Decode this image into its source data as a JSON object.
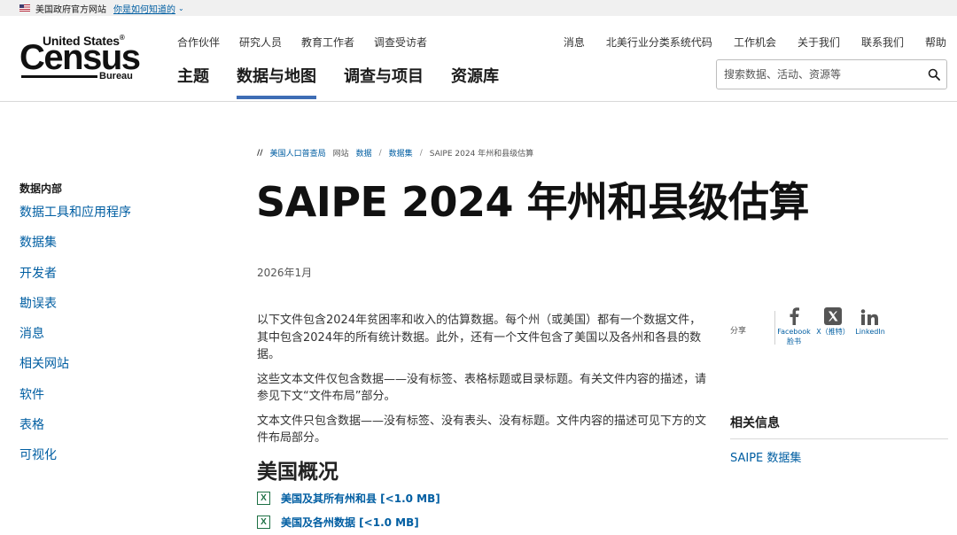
{
  "gov_banner": {
    "text": "美国政府官方网站",
    "link": "你是如何知道的"
  },
  "logo": {
    "line1": "United States",
    "reg": "®",
    "line2": "Census",
    "line3": "Bureau"
  },
  "utility_nav": [
    "合作伙伴",
    "研究人员",
    "教育工作者",
    "调查受访者"
  ],
  "right_nav": [
    "消息",
    "北美行业分类系统代码",
    "工作机会",
    "关于我们",
    "联系我们",
    "帮助"
  ],
  "main_nav": [
    {
      "label": "主题",
      "active": false
    },
    {
      "label": "数据与地图",
      "active": true
    },
    {
      "label": "调查与项目",
      "active": false
    },
    {
      "label": "资源库",
      "active": false
    }
  ],
  "search": {
    "placeholder": "搜索数据、活动、资源等"
  },
  "sidebar": {
    "heading": "数据内部",
    "items": [
      "数据工具和应用程序",
      "数据集",
      "开发者",
      "勘误表",
      "消息",
      "相关网站",
      "软件",
      "表格",
      "可视化"
    ]
  },
  "breadcrumb": {
    "lead": "//",
    "items": [
      {
        "label": "美国人口普查局",
        "link": true
      },
      {
        "label": "网站",
        "link": false
      },
      {
        "label": "数据",
        "link": true
      },
      {
        "label": "/",
        "link": false
      },
      {
        "label": "数据集",
        "link": true
      },
      {
        "label": "/",
        "link": false
      },
      {
        "label": "SAIPE 2024 年州和县级估算",
        "link": false
      }
    ]
  },
  "page": {
    "title": "SAIPE 2024 年州和县级估算",
    "date": "2026年1月",
    "paragraphs": [
      "以下文件包含2024年贫困率和收入的估算数据。每个州（或美国）都有一个数据文件，其中包含2024年的所有统计数据。此外，还有一个文件包含了美国以及各州和各县的数据。",
      "这些文本文件仅包含数据——没有标签、表格标题或目录标题。有关文件内容的描述，请参见下文“文件布局”部分。",
      "文本文件只包含数据——没有标签、没有表头、没有标题。文件内容的描述可见下方的文件布局部分。"
    ],
    "section_title": "美国概况",
    "files": [
      {
        "icon": "X",
        "label": "美国及其所有州和县 [<1.0 MB]"
      },
      {
        "icon": "X",
        "label": "美国及各州数据 [<1.0 MB]"
      }
    ]
  },
  "share": {
    "label": "分享",
    "items": [
      {
        "icon": "facebook-icon",
        "label": "Facebook\n脸书"
      },
      {
        "icon": "x-icon",
        "label": "X（推特）"
      },
      {
        "icon": "linkedin-icon",
        "label": "LinkedIn"
      }
    ]
  },
  "related": {
    "title": "相关信息",
    "link": "SAIPE 数据集"
  },
  "colors": {
    "link": "#005ea2",
    "nav_active": "#3e6db5",
    "excel_green": "#1d7044"
  }
}
